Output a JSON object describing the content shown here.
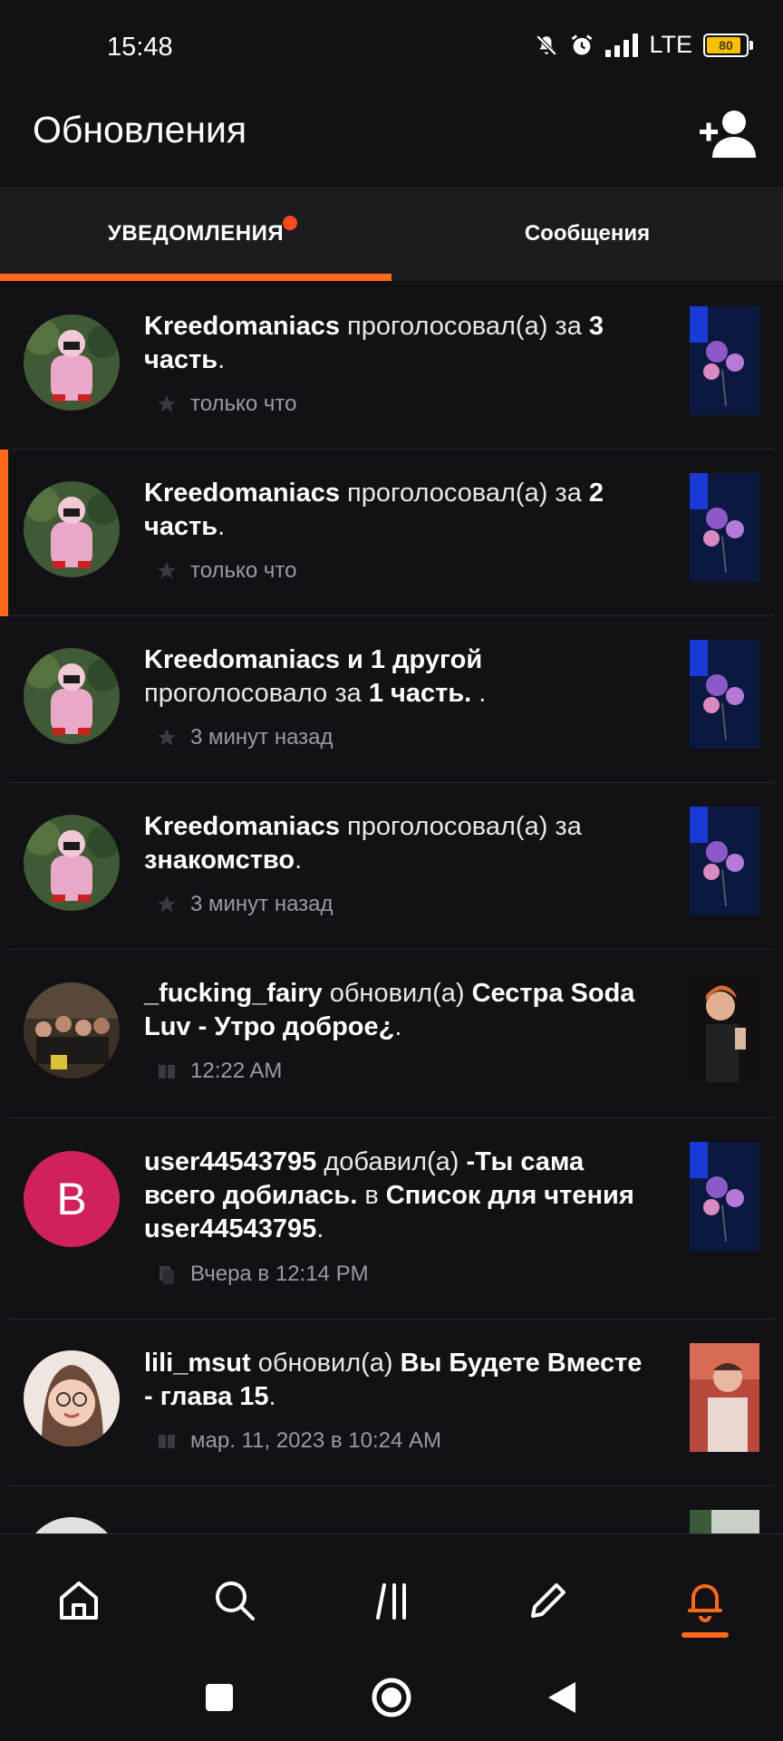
{
  "status_bar": {
    "time": "15:48",
    "network": "LTE",
    "battery": "80"
  },
  "header": {
    "title": "Обновления"
  },
  "tabs": [
    {
      "label": "УВЕДОМЛЕНИЯ"
    },
    {
      "label": "Сообщения"
    }
  ],
  "feed": [
    {
      "user": "Kreedomaniacs",
      "action": " проголосовал(а) за ",
      "target": "3 часть",
      "tail": ".",
      "time": "только что"
    },
    {
      "user": "Kreedomaniacs",
      "action": " проголосовал(а) за ",
      "target": "2 часть",
      "tail": ".",
      "time": "только что"
    },
    {
      "user": "Kreedomaniacs и 1 другой",
      "action": " проголосовало за ",
      "target": "1 часть. ",
      "tail": ".",
      "time": "3 минут назад"
    },
    {
      "user": "Kreedomaniacs",
      "action": " проголосовал(а) за ",
      "target": "знакомство",
      "tail": ".",
      "time": "3 минут назад"
    },
    {
      "user": "_fucking_fairy",
      "action": " обновил(а) ",
      "target": "Сестра Soda Luv - Утро доброе¿",
      "tail": ".",
      "time": "12:22 AM"
    },
    {
      "user": "user44543795",
      "action": " добавил(а) ",
      "target": "-Ты сама всего добилась.",
      "mid": " в ",
      "target2": "Список для чтения user44543795",
      "tail": ".",
      "avatar_letter": "B",
      "time": "Вчера в 12:14 PM"
    },
    {
      "user": "lili_msut",
      "action": " обновил(а) ",
      "target": "Вы Будете Вместе - глава 15",
      "tail": ".",
      "time": "мар. 11, 2023 в 10:24 AM"
    }
  ],
  "colors": {
    "accent": "#ff6a1a",
    "background": "#121116",
    "tab_background": "#1c1b20",
    "avatar_letter_bg": "#d0225a"
  },
  "icons": [
    "add-user-icon",
    "home-icon",
    "search-icon",
    "library-icon",
    "pencil-icon",
    "bell-icon",
    "star-icon",
    "book-icon",
    "list-icon"
  ]
}
